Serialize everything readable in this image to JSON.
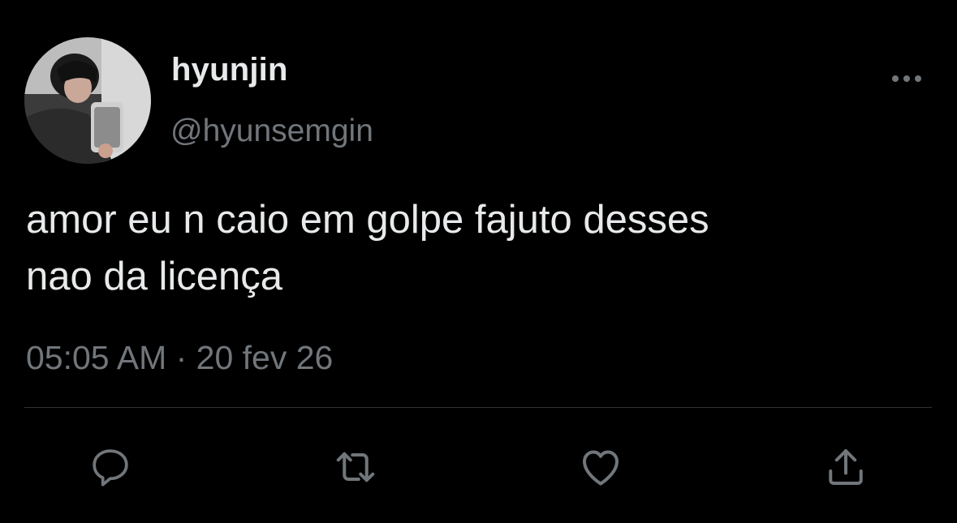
{
  "user": {
    "display_name": "hyunjin",
    "handle": "@hyunsemgin"
  },
  "tweet": {
    "lines": [
      "amor eu n caio em golpe fajuto desses",
      "nao da licença"
    ],
    "timestamp": "05:05 AM · 20 fev 26"
  },
  "icons": {
    "more": "more-dots-icon",
    "reply": "reply-icon",
    "retweet": "retweet-icon",
    "like": "heart-icon",
    "share": "share-icon"
  },
  "colors": {
    "background": "#000000",
    "primary_text": "#e7e9ea",
    "secondary_text": "#71767b",
    "divider": "#2f3336"
  }
}
